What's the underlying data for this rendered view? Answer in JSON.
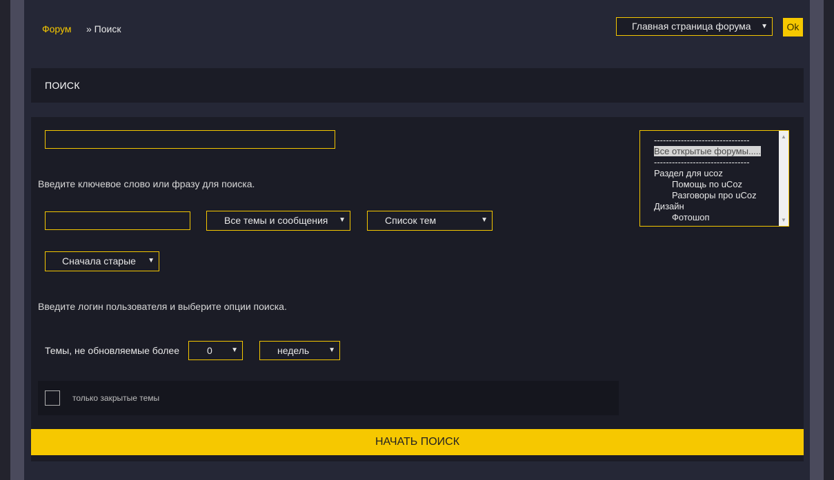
{
  "breadcrumb": {
    "forum": "Форум",
    "current": "» Поиск"
  },
  "jump": {
    "selected": "Главная страница форума",
    "ok_label": "Ok"
  },
  "title": "ПОИСК",
  "search": {
    "keyword_value": "",
    "keyword_hint": "Введите ключевое слово или фразу для поиска.",
    "user_value": "",
    "scope_selected": "Все темы и сообщения",
    "view_selected": "Список тем",
    "order_selected": "Сначала старые",
    "user_hint": "Введите логин пользователя и выберите опции поиска.",
    "age_label": "Темы, не обновляемые более",
    "age_value": "0",
    "age_unit": "недель",
    "closed_only_label": "только закрытые темы",
    "submit_label": "НАЧАТЬ ПОИСК"
  },
  "forums": [
    {
      "label": "--------------------------------",
      "indent": false,
      "selected": false
    },
    {
      "label": "Все открытые форумы.....",
      "indent": false,
      "selected": true
    },
    {
      "label": "--------------------------------",
      "indent": false,
      "selected": false
    },
    {
      "label": "Раздел для ucoz",
      "indent": false,
      "selected": false
    },
    {
      "label": "Помощь по uCoz",
      "indent": true,
      "selected": false
    },
    {
      "label": "Разговоры про uCoz",
      "indent": true,
      "selected": false
    },
    {
      "label": "Дизайн",
      "indent": false,
      "selected": false
    },
    {
      "label": "Фотошоп",
      "indent": true,
      "selected": false
    }
  ],
  "colors": {
    "accent": "#f6c800",
    "panel": "#1b1c26",
    "page": "#252736"
  }
}
